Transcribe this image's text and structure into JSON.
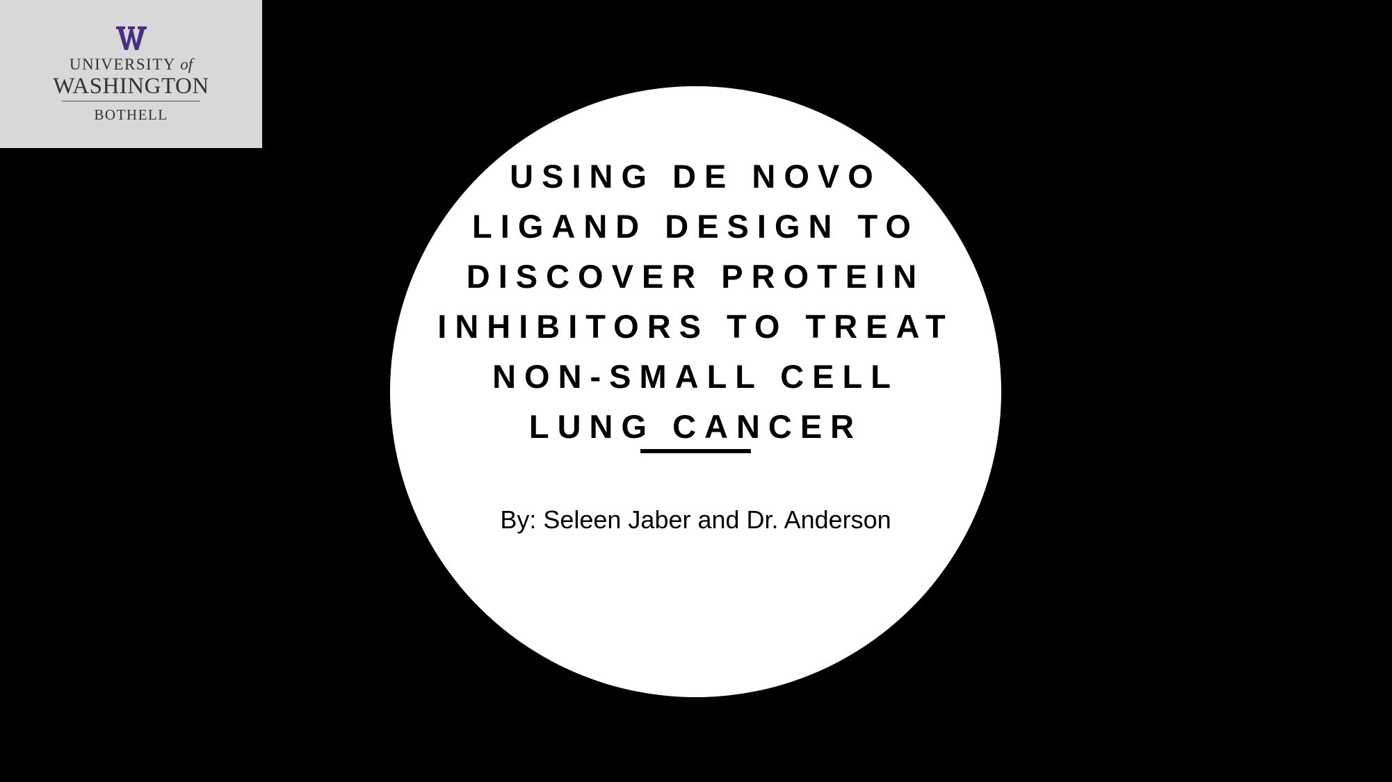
{
  "logo": {
    "mark": "W",
    "line1_main": "UNIVERSITY",
    "line1_of": "of",
    "line2": "WASHINGTON",
    "line3": "BOTHELL",
    "colors": {
      "mark": "#4b2e83",
      "text": "#333333",
      "background": "#d8d8d8"
    }
  },
  "slide": {
    "title_lines": [
      "USING DE NOVO",
      "LIGAND DESIGN TO",
      "DISCOVER PROTEIN",
      "INHIBITORS TO TREAT",
      "NON-SMALL CELL",
      "LUNG CANCER"
    ],
    "byline": "By: Seleen Jaber and Dr. Anderson",
    "colors": {
      "background": "#000000",
      "circle": "#ffffff",
      "text": "#000000"
    }
  }
}
